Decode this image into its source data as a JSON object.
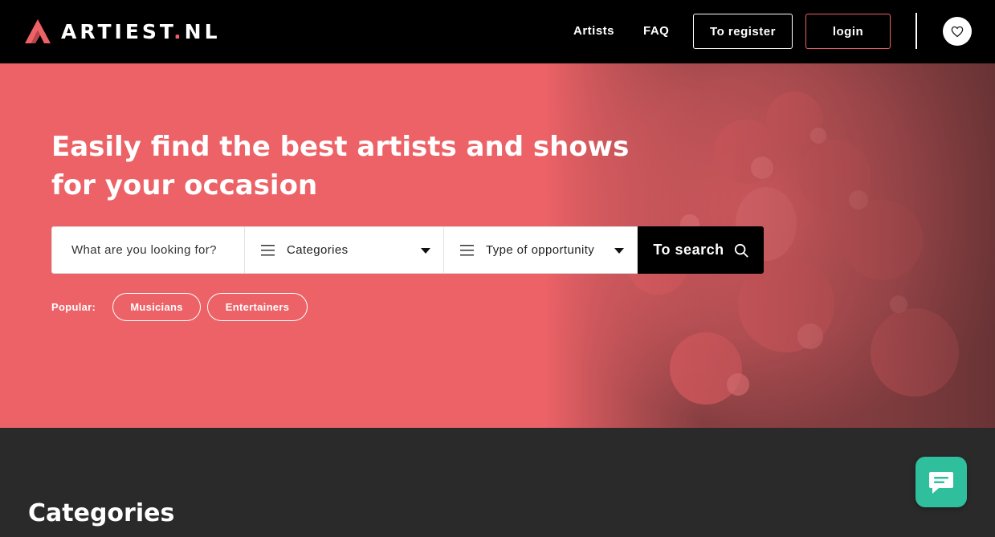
{
  "header": {
    "logo_text": "ARTIEST",
    "logo_dot": ".",
    "logo_tld": "NL",
    "nav": [
      {
        "label": "Artists"
      },
      {
        "label": "FAQ"
      }
    ],
    "register_label": "To register",
    "login_label": "login"
  },
  "hero": {
    "title": "Easily find the best artists and shows for your occasion",
    "search": {
      "placeholder": "What are you looking for?",
      "categories_label": "Categories",
      "type_label": "Type of opportunity",
      "button_label": "To search"
    },
    "popular_label": "Popular:",
    "popular_chips": [
      "Musicians",
      "Entertainers"
    ]
  },
  "categories": {
    "title": "Categories"
  },
  "colors": {
    "brand": "#ec6267",
    "header_bg": "#000000",
    "section_bg": "#2a2a2a",
    "chat_accent": "#2fbf9d"
  },
  "icons": {
    "logo": "logo-a-icon",
    "favorite": "heart-icon",
    "menu": "menu-lines-icon",
    "dropdown": "caret-down-icon",
    "search": "search-icon",
    "chat": "chat-bubble-icon"
  }
}
